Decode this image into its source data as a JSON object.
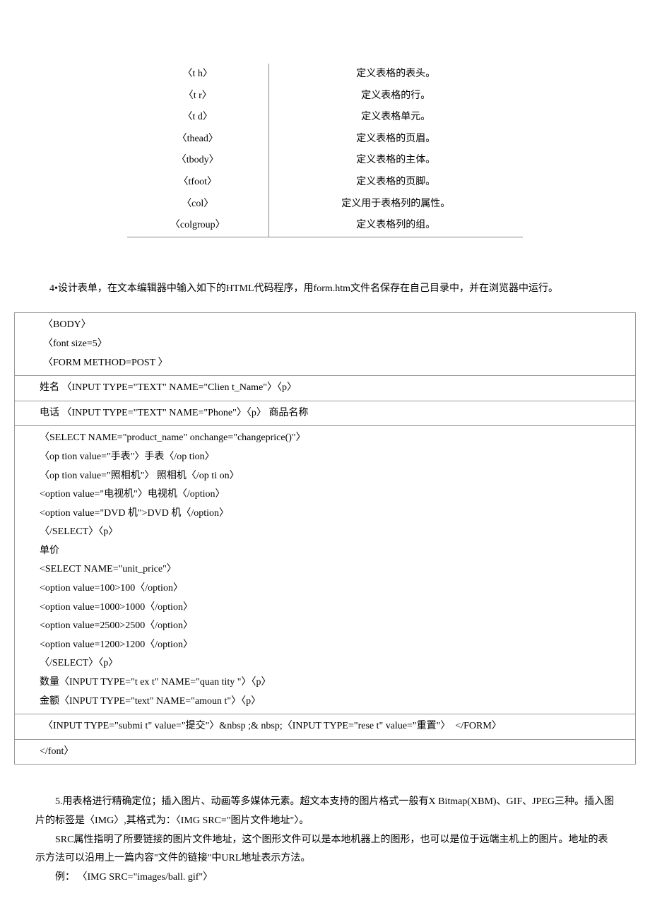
{
  "table": {
    "rows": [
      {
        "tag": "〈t h〉",
        "desc": "定义表格的表头。"
      },
      {
        "tag": "〈t r〉",
        "desc": "定义表格的行。"
      },
      {
        "tag": "〈t d〉",
        "desc": "定义表格单元。"
      },
      {
        "tag": "〈thead〉",
        "desc": "定义表格的页眉。"
      },
      {
        "tag": "〈tbody〉",
        "desc": "定义表格的主体。"
      },
      {
        "tag": "〈tfoot〉",
        "desc": "定义表格的页脚。"
      },
      {
        "tag": "〈col〉",
        "desc": "定义用于表格列的属性。"
      },
      {
        "tag": "〈colgroup〉",
        "desc": "定义表格列的组。"
      }
    ]
  },
  "intro4": "4•设计表单，在文本编辑器中输入如下的HTML代码程序，用form.htm文件名保存在自己目录中，并在浏览器中运行。",
  "code": {
    "seg1": "〈BODY〉\n〈font size=5〉\n〈FORM METHOD=POST 〉",
    "seg2": "姓名 〈INPUT TYPE=\"TEXT\" NAME=\"Clien t_Name\"〉〈p〉",
    "seg3": "电话 〈INPUT TYPE=\"TEXT\" NAME=\"Phone\"〉〈p〉 商品名称",
    "seg4": "〈SELECT NAME=\"product_name\" onchange=\"changeprice()\"〉\n〈op tion value=\"手表\"〉手表〈/op tion〉\n〈op tion value=\"照相机\"〉 照相机〈/op ti on〉\n<option value=\"电视机\"〉电视机〈/option〉\n<option value=\"DVD 机\">DVD 机〈/option〉\n〈/SELECT〉〈p〉\n单价\n<SELECT NAME=\"unit_price\"〉\n<option value=100>100〈/option〉\n<option value=1000>1000〈/option〉\n<option value=2500>2500〈/option〉\n<option value=1200>1200〈/option〉\n〈/SELECT〉〈p〉\n数量〈INPUT TYPE=\"t ex t\" NAME=\"quan tity \"〉〈p〉\n金额〈INPUT TYPE=\"text\" NAME=\"amoun t\"〉〈p〉",
    "seg5": "〈INPUT TYPE=\"submi t\" value=\"提交\"〉&nbsp ;& nbsp;〈INPUT TYPE=\"rese t\" value=\"重置\"〉  </FORM〉",
    "seg6": "</font〉"
  },
  "para5": {
    "l1": "5.用表格进行精确定位；插入图片、动画等多媒体元素。超文本支持的图片格式一般有X Bitmap(XBM)、GIF、JPEG三种。插入图片的标签是〈IMG〉,其格式为：〈IMG SRC=\"图片文件地址\"〉。",
    "l2": "SRC属性指明了所要链接的图片文件地址，这个图形文件可以是本地机器上的图形，也可以是位于远端主机上的图片。地址的表示方法可以沿用上一篇内容\"文件的链接\"中URL地址表示方法。",
    "l3": "例： 〈IMG SRC=\"images/ball. gif\"〉"
  }
}
